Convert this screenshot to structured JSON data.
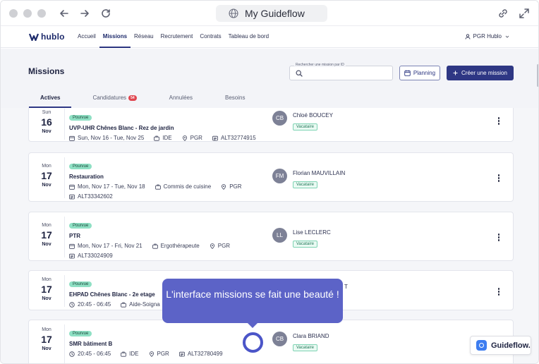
{
  "browser": {
    "address_title": "My Guideflow"
  },
  "app": {
    "logo_text": "hublo",
    "menu": [
      "Accueil",
      "Missions",
      "Réseau",
      "Recrutement",
      "Contrats",
      "Tableau de bord"
    ],
    "active_menu": "Missions",
    "user_label": "PGR Hublo"
  },
  "page": {
    "title": "Missions",
    "search_label": "Rechercher une mission par ID",
    "planning_label": "Planning",
    "create_label": "Créer une mission",
    "tabs": [
      {
        "label": "Actives",
        "badge": ""
      },
      {
        "label": "Candidatures",
        "badge": "54"
      },
      {
        "label": "Annulées",
        "badge": ""
      },
      {
        "label": "Besoins",
        "badge": ""
      }
    ]
  },
  "missions": [
    {
      "dow": "Sun",
      "day": "16",
      "mon": "Nov",
      "status": "Pourvue",
      "title": "UVP-UHR Chênes Blanc - Rez de jardin",
      "dates": "Sun, Nov 16 - Tue, Nov 25",
      "role": "IDE",
      "site": "PGR",
      "ref": "ALT32774915",
      "person_initials": "CB",
      "person_name": "Chloé BOUCEY",
      "person_tag": "Vacataire"
    },
    {
      "dow": "Mon",
      "day": "17",
      "mon": "Nov",
      "status": "Pourvue",
      "title": "Restauration",
      "dates": "Mon, Nov 17 - Tue, Nov 18",
      "role": "Commis de cuisine",
      "site": "PGR",
      "ref": "ALT33342602",
      "person_initials": "FM",
      "person_name": "Florian MAUVILLAIN",
      "person_tag": "Vacataire"
    },
    {
      "dow": "Mon",
      "day": "17",
      "mon": "Nov",
      "status": "Pourvue",
      "title": "PTR",
      "dates": "Mon, Nov 17 - Fri, Nov 21",
      "role": "Ergothérapeute",
      "site": "PGR",
      "ref": "ALT33024909",
      "person_initials": "LL",
      "person_name": "Lise LECLERC",
      "person_tag": "Vacataire"
    },
    {
      "dow": "Mon",
      "day": "17",
      "mon": "Nov",
      "status": "Pourvue",
      "title": "EHPAD Chênes Blanc - 2e etage",
      "dates": "20:45 - 06:45",
      "role": "Aide-Soigna",
      "person_name_partial": "T"
    },
    {
      "dow": "Mon",
      "day": "17",
      "mon": "Nov",
      "status": "Pourvue",
      "title": "SMR bâtiment B",
      "dates": "20:45 - 06:45",
      "role": "IDE",
      "site": "PGR",
      "ref": "ALT32780499",
      "person_initials": "CB",
      "person_name": "Clara BRIAND",
      "person_tag": "Vacataire"
    }
  ],
  "tooltip": {
    "text": "L'interface missions se fait une beauté !"
  },
  "guideflow_badge": "Guideflow.",
  "colors": {
    "brand": "#2e3784",
    "tooltip": "#5c63c7",
    "status_tag": "#8fe0c4",
    "badge": "#e0454f"
  }
}
